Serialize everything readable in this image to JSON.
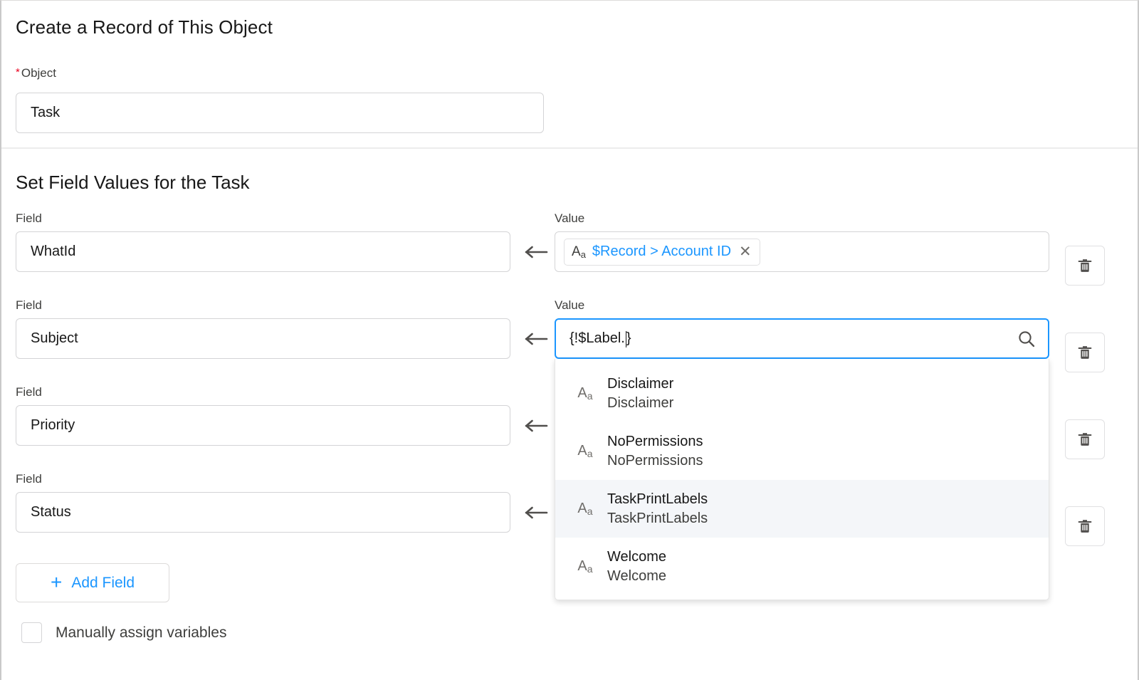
{
  "object_section": {
    "title": "Create a Record of This Object",
    "object_label": "Object",
    "required_marker": "*",
    "object_value": "Task"
  },
  "fields_section": {
    "title": "Set Field Values for the Task",
    "field_column_label": "Field",
    "value_column_label": "Value",
    "rows": [
      {
        "field_label": "Field",
        "field_value": "WhatId",
        "value_label": "Value",
        "value_kind": "pill",
        "pill_icon": "text-datatype-icon",
        "pill_text": "$Record > Account ID",
        "pill_remove": "✕",
        "delete_icon": "trash-icon"
      },
      {
        "field_label": "Field",
        "field_value": "Subject",
        "value_label": "Value",
        "value_kind": "combobox",
        "input_value": "{!$Label.",
        "input_value_suffix": "}",
        "search_icon": "search-icon",
        "delete_icon": "trash-icon"
      },
      {
        "field_label": "Field",
        "field_value": "Priority",
        "value_kind": "hidden",
        "delete_icon": "trash-icon"
      },
      {
        "field_label": "Field",
        "field_value": "Status",
        "value_kind": "hidden",
        "delete_icon": "trash-icon"
      }
    ],
    "dropdown": {
      "items": [
        {
          "icon": "text-datatype-icon",
          "primary": "Disclaimer",
          "secondary": "Disclaimer",
          "selected": false
        },
        {
          "icon": "text-datatype-icon",
          "primary": "NoPermissions",
          "secondary": "NoPermissions",
          "selected": false
        },
        {
          "icon": "text-datatype-icon",
          "primary": "TaskPrintLabels",
          "secondary": "TaskPrintLabels",
          "selected": true
        },
        {
          "icon": "text-datatype-icon",
          "primary": "Welcome",
          "secondary": "Welcome",
          "selected": false
        }
      ]
    },
    "add_field": {
      "plus": "+",
      "label": "Add Field",
      "icon": "plus-icon"
    },
    "manual_assign": {
      "label": "Manually assign variables",
      "checked": false
    }
  },
  "icons": {
    "arrow_left": "arrow-left-icon",
    "aa_upper": "A",
    "aa_lower": "a"
  },
  "colors": {
    "accent_blue": "#1b96ff",
    "required_red": "#ea001e",
    "text_primary": "#181818",
    "text_secondary": "#3e3e3c",
    "border": "#d4d4d6",
    "row_highlight": "#f4f6f9"
  }
}
